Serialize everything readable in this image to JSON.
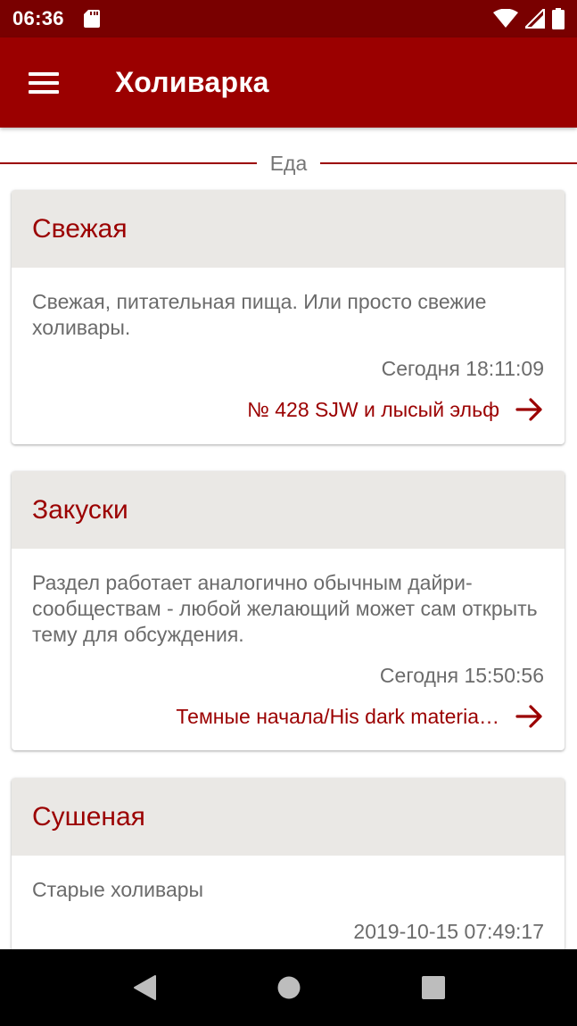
{
  "status_bar": {
    "time": "06:36",
    "icons": [
      "sd-card-icon",
      "wifi-icon",
      "signal-icon",
      "battery-icon"
    ]
  },
  "app_bar": {
    "title": "Холиварка",
    "menu_icon": "hamburger-menu-icon"
  },
  "section": {
    "label": "Еда"
  },
  "cards": [
    {
      "title": "Свежая",
      "description": "Свежая, питательная пища. Или просто свежие холивары.",
      "date": "Сегодня 18:11:09",
      "last_topic": "№ 428 SJW и лысый эльф"
    },
    {
      "title": "Закуски",
      "description": "Раздел работает аналогично обычным дайри-сообществам - любой желающий может сам открыть тему для обсуждения.",
      "date": "Сегодня 15:50:56",
      "last_topic": "Темные начала/His dark materia…"
    },
    {
      "title": "Сушеная",
      "description": "Старые холивары",
      "date": "2019-10-15 07:49:17",
      "last_topic": ""
    }
  ],
  "nav_bar": {
    "icons": [
      "back-triangle-icon",
      "home-circle-icon",
      "recents-square-icon"
    ]
  },
  "colors": {
    "status_bar": "#790000",
    "app_bar": "#9b0000",
    "accent": "#9b0000",
    "card_header": "#eae8e5",
    "text_secondary": "#6b6b6b"
  }
}
